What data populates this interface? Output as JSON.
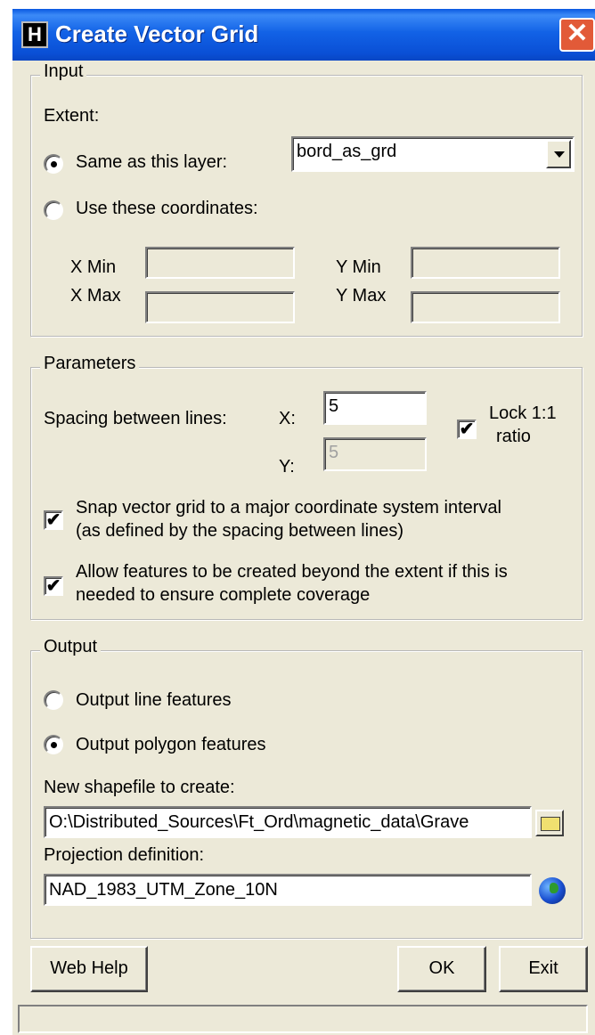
{
  "window": {
    "title": "Create Vector Grid",
    "icon_letter": "H",
    "close_glyph": "✕"
  },
  "input": {
    "legend": "Input",
    "extent_label": "Extent:",
    "same_layer_label": "Same as this layer:",
    "layer_value": "bord_as_grd",
    "use_coords_label": "Use these coordinates:",
    "xmin_label": "X Min",
    "xmax_label": "X Max",
    "ymin_label": "Y Min",
    "ymax_label": "Y Max",
    "selected_extent": "same_layer"
  },
  "parameters": {
    "legend": "Parameters",
    "spacing_label": "Spacing between lines:",
    "x_label": "X:",
    "x_value": "5",
    "y_label": "Y:",
    "y_value": "5",
    "lock_label_1": "Lock 1:1",
    "lock_label_2": "ratio",
    "lock_checked": true,
    "snap_label_1": "Snap vector grid to a major coordinate system interval",
    "snap_label_2": "(as defined by the spacing between lines)",
    "snap_checked": true,
    "allow_label_1": "Allow features to be created beyond the extent if this is",
    "allow_label_2": "needed to ensure complete coverage",
    "allow_checked": true
  },
  "output": {
    "legend": "Output",
    "line_label": "Output line features",
    "polygon_label": "Output polygon features",
    "selected": "polygon",
    "shapefile_label": "New shapefile to create:",
    "shapefile_value": "O:\\Distributed_Sources\\Ft_Ord\\magnetic_data\\Grave",
    "projection_label": "Projection definition:",
    "projection_value": "NAD_1983_UTM_Zone_10N"
  },
  "buttons": {
    "web_help": "Web Help",
    "ok": "OK",
    "exit": "Exit"
  },
  "check_glyph": "✔"
}
